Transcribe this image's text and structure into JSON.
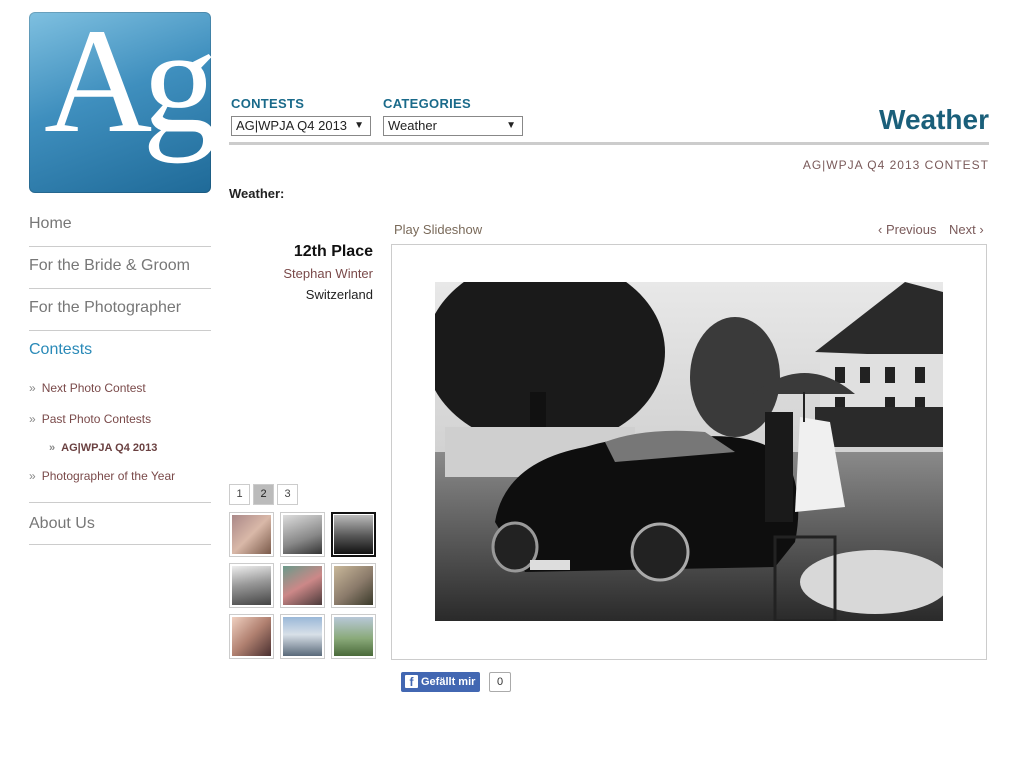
{
  "logo": {
    "text": "Ag"
  },
  "nav": {
    "home": "Home",
    "bride_groom": "For the Bride & Groom",
    "photographer": "For the Photographer",
    "contests": "Contests",
    "sub": {
      "next": "Next Photo Contest",
      "past": "Past Photo Contests",
      "current": "AG|WPJA Q4 2013",
      "poty": "Photographer of the Year"
    },
    "about": "About Us",
    "bullet": "»"
  },
  "header": {
    "contests_label": "CONTESTS",
    "contests_value": "AG|WPJA Q4 2013",
    "categories_label": "CATEGORIES",
    "categories_value": "Weather",
    "arrow": "▼",
    "title": "Weather",
    "contest_caption": "AG|WPJA Q4 2013 CONTEST",
    "category_heading": "Weather:"
  },
  "result": {
    "place": "12th Place",
    "photographer": "Stephan Winter",
    "country": "Switzerland"
  },
  "pager": {
    "pages": [
      "1",
      "2",
      "3"
    ],
    "current": "2"
  },
  "viewer": {
    "slideshow": "Play Slideshow",
    "previous": "‹ Previous",
    "next": "Next ›"
  },
  "social": {
    "like_label": "Gefällt mir",
    "fb_glyph": "f",
    "count": "0"
  },
  "colors": {
    "accent": "#2a8ab8",
    "title": "#1a5f7a",
    "facebook": "#4267b2"
  }
}
